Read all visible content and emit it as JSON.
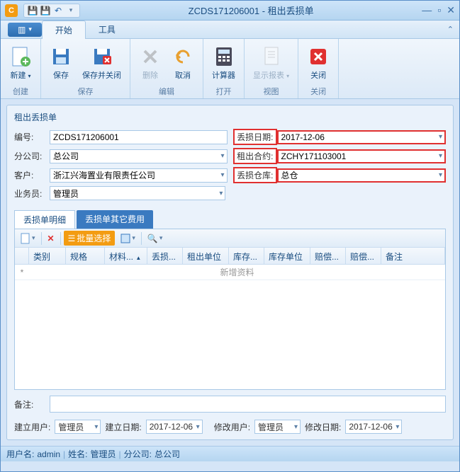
{
  "window": {
    "title": "ZCDS171206001 - 租出丢损单"
  },
  "menu": {
    "start": "开始",
    "tools": "工具"
  },
  "ribbon": {
    "new": "新建",
    "save": "保存",
    "save_close": "保存并关闭",
    "delete": "删除",
    "cancel": "取消",
    "calc": "计算器",
    "report": "显示报表",
    "close": "关闭",
    "g_create": "创建",
    "g_save": "保存",
    "g_edit": "编辑",
    "g_open": "打开",
    "g_view": "视图",
    "g_close": "关闭"
  },
  "panel": {
    "title": "租出丢损单"
  },
  "form": {
    "number_label": "编号:",
    "number": "ZCDS171206001",
    "lossdate_label": "丢损日期:",
    "lossdate": "2017-12-06",
    "branch_label": "分公司:",
    "branch": "总公司",
    "contract_label": "租出合约:",
    "contract": "ZCHY171103001",
    "customer_label": "客户:",
    "customer": "浙江兴海置业有限责任公司",
    "warehouse_label": "丢损仓库:",
    "warehouse": "总仓",
    "salesman_label": "业务员:",
    "salesman": "管理员"
  },
  "tabs": {
    "detail": "丢损单明细",
    "other": "丢损单其它费用"
  },
  "toolbar": {
    "batch": "批量选择"
  },
  "grid": {
    "cols": [
      "类别",
      "规格",
      "材料...",
      "丢损...",
      "租出单位",
      "库存...",
      "库存单位",
      "赔偿...",
      "赔偿...",
      "备注"
    ],
    "addrow": "新增资料"
  },
  "remark": {
    "label": "备注:"
  },
  "audit": {
    "create_user_label": "建立用户:",
    "create_user": "管理员",
    "create_date_label": "建立日期:",
    "create_date": "2017-12-06",
    "modify_user_label": "修改用户:",
    "modify_user": "管理员",
    "modify_date_label": "修改日期:",
    "modify_date": "2017-12-06"
  },
  "status": {
    "user_label": "用户名:",
    "user": "admin",
    "name_label": "姓名:",
    "name": "管理员",
    "branch_label": "分公司:",
    "branch": "总公司"
  }
}
